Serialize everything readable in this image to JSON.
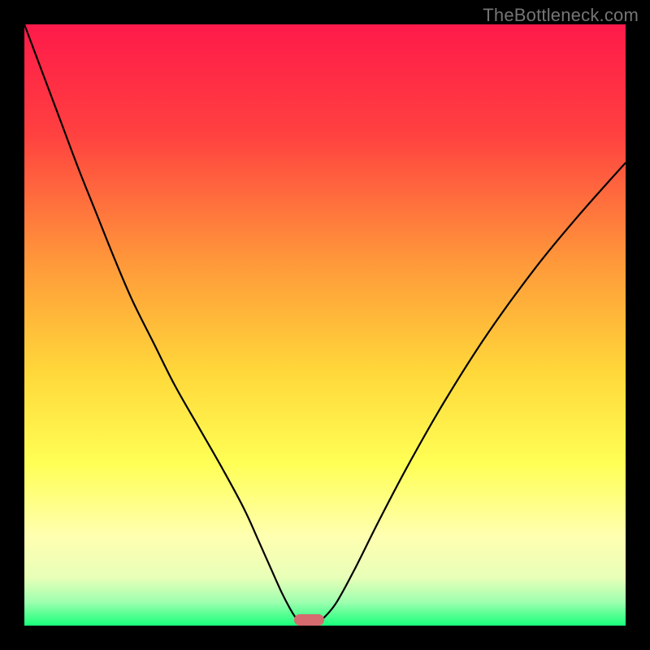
{
  "watermark": "TheBottleneck.com",
  "chart_data": {
    "type": "line",
    "title": "",
    "xlabel": "",
    "ylabel": "",
    "xlim": [
      0,
      100
    ],
    "ylim": [
      0,
      100
    ],
    "gradient_stops": [
      {
        "offset": 0,
        "color": "#ff1a4a"
      },
      {
        "offset": 18,
        "color": "#ff4040"
      },
      {
        "offset": 40,
        "color": "#ff9a3a"
      },
      {
        "offset": 58,
        "color": "#ffd83a"
      },
      {
        "offset": 73,
        "color": "#ffff55"
      },
      {
        "offset": 85,
        "color": "#ffffb0"
      },
      {
        "offset": 92,
        "color": "#e8ffb8"
      },
      {
        "offset": 96,
        "color": "#a0ffb0"
      },
      {
        "offset": 100,
        "color": "#18ff7a"
      }
    ],
    "series": [
      {
        "name": "left-branch",
        "x": [
          0.0,
          3.0,
          6.0,
          9.0,
          12.0,
          15.0,
          18.0,
          21.5,
          25.0,
          29.0,
          33.0,
          36.5,
          39.0,
          41.0,
          42.8,
          44.2,
          45.2,
          45.8
        ],
        "y": [
          100.0,
          92.0,
          84.0,
          76.0,
          68.5,
          61.0,
          54.0,
          47.0,
          40.0,
          33.0,
          26.0,
          19.5,
          14.0,
          9.5,
          5.5,
          2.8,
          1.2,
          0.5
        ]
      },
      {
        "name": "right-branch",
        "x": [
          48.8,
          50.0,
          52.0,
          55.0,
          59.0,
          64.0,
          70.0,
          77.0,
          85.0,
          92.0,
          100.0
        ],
        "y": [
          0.5,
          1.5,
          4.0,
          9.5,
          17.5,
          27.0,
          37.5,
          48.5,
          59.5,
          68.0,
          77.0
        ]
      }
    ],
    "marker": {
      "x_center": 47.3,
      "width": 5.0,
      "color": "#d56a6f"
    }
  }
}
